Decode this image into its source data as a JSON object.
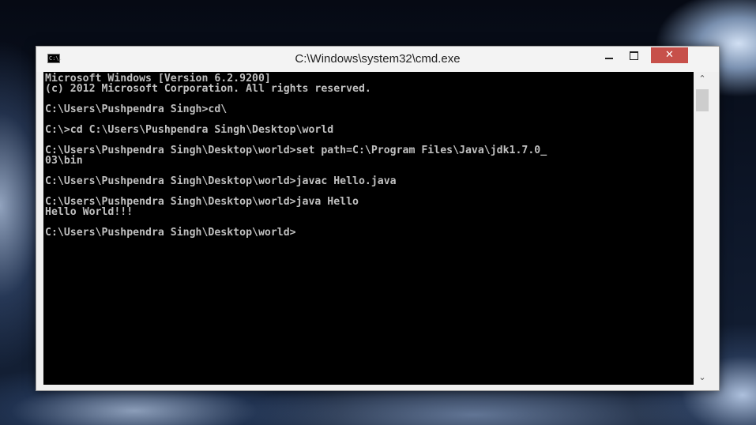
{
  "window": {
    "title": "C:\\Windows\\system32\\cmd.exe",
    "app_icon_label": "C:\\.",
    "controls": {
      "minimize_icon": "minimize-icon",
      "maximize_icon": "maximize-icon",
      "close_glyph": "✕"
    }
  },
  "console": {
    "lines": [
      "Microsoft Windows [Version 6.2.9200]",
      "(c) 2012 Microsoft Corporation. All rights reserved.",
      "",
      "C:\\Users\\Pushpendra Singh>cd\\",
      "",
      "C:\\>cd C:\\Users\\Pushpendra Singh\\Desktop\\world",
      "",
      "C:\\Users\\Pushpendra Singh\\Desktop\\world>set path=C:\\Program Files\\Java\\jdk1.7.0_",
      "03\\bin",
      "",
      "C:\\Users\\Pushpendra Singh\\Desktop\\world>javac Hello.java",
      "",
      "C:\\Users\\Pushpendra Singh\\Desktop\\world>java Hello",
      "Hello World!!!",
      "",
      "C:\\Users\\Pushpendra Singh\\Desktop\\world>"
    ],
    "background_color": "#000000",
    "text_color": "#c0c0c0"
  },
  "scrollbar": {
    "up_glyph": "⌃",
    "down_glyph": "⌄"
  }
}
